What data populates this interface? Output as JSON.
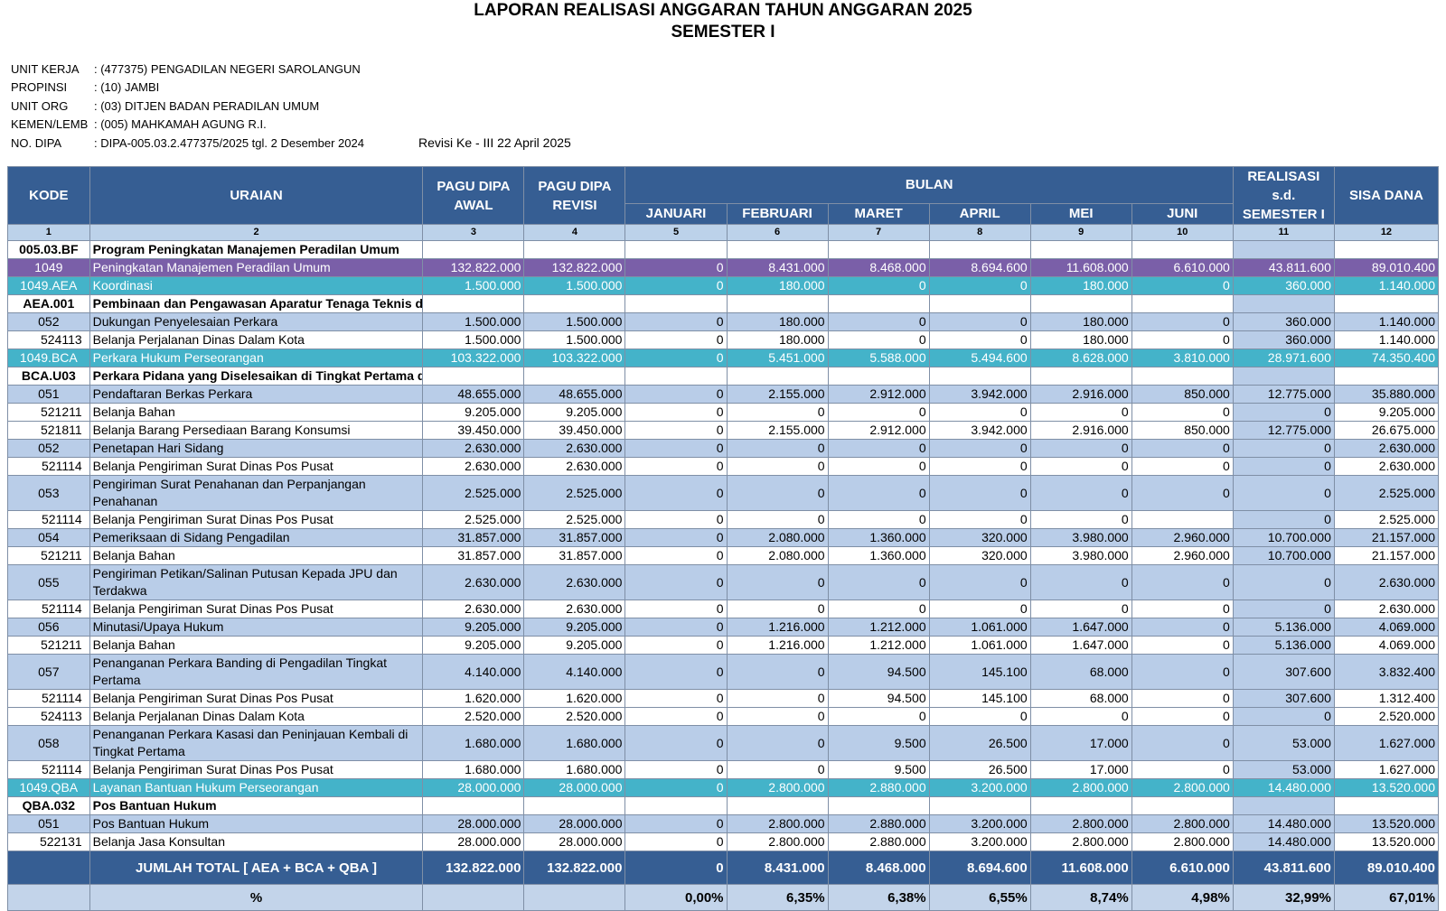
{
  "title": "LAPORAN REALISASI ANGGARAN TAHUN ANGGARAN 2025",
  "subtitle": "SEMESTER I",
  "info": [
    {
      "label": "UNIT KERJA",
      "value": ": (477375) PENGADILAN NEGERI SAROLANGUN"
    },
    {
      "label": "PROPINSI",
      "value": ": (10) JAMBI"
    },
    {
      "label": "UNIT ORG",
      "value": ": (03) DITJEN BADAN PERADILAN UMUM"
    },
    {
      "label": "KEMEN/LEMB",
      "value": ": (005) MAHKAMAH AGUNG R.I."
    },
    {
      "label": "NO. DIPA",
      "value": ": DIPA-005.03.2.477375/2025 tgl. 2 Desember 2024"
    }
  ],
  "revisi": "Revisi Ke - III 22 April 2025",
  "header": {
    "kode": "KODE",
    "uraian": "URAIAN",
    "pagu_awal": "PAGU DIPA AWAL",
    "pagu_revisi": "PAGU DIPA REVISI",
    "bulan": "BULAN",
    "months": [
      "JANUARI",
      "FEBRUARI",
      "MARET",
      "APRIL",
      "MEI",
      "JUNI"
    ],
    "realisasi": "REALISASI s.d. SEMESTER I",
    "sisa": "SISA DANA",
    "numbers": [
      "1",
      "2",
      "3",
      "4",
      "5",
      "6",
      "7",
      "8",
      "9",
      "10",
      "11",
      "12"
    ]
  },
  "rows": [
    {
      "style": "prog",
      "kode": "005.03.BF",
      "uraian": "Program Peningkatan Manajemen Peradilan Umum",
      "v": [
        "",
        "",
        "",
        "",
        "",
        "",
        "",
        "",
        "",
        ""
      ]
    },
    {
      "style": "purple",
      "kode": "1049",
      "uraian": "Peningkatan Manajemen Peradilan Umum",
      "v": [
        "132.822.000",
        "132.822.000",
        "0",
        "8.431.000",
        "8.468.000",
        "8.694.600",
        "11.608.000",
        "6.610.000",
        "43.811.600",
        "89.010.400"
      ]
    },
    {
      "style": "teal",
      "kode": "1049.AEA",
      "uraian": "Koordinasi",
      "v": [
        "1.500.000",
        "1.500.000",
        "0",
        "180.000",
        "0",
        "0",
        "180.000",
        "0",
        "360.000",
        "1.140.000"
      ]
    },
    {
      "style": "prog",
      "kode": "AEA.001",
      "uraian": "Pembinaan dan Pengawasan Aparatur Tenaga Teknis di Lingkungan Peradilan Umum",
      "v": [
        "",
        "",
        "",
        "",
        "",
        "",
        "",
        "",
        "",
        ""
      ]
    },
    {
      "style": "blue",
      "kode": "052",
      "uraian": "Dukungan Penyelesaian Perkara",
      "v": [
        "1.500.000",
        "1.500.000",
        "0",
        "180.000",
        "0",
        "0",
        "180.000",
        "0",
        "360.000",
        "1.140.000"
      ]
    },
    {
      "style": "white",
      "kode": "524113",
      "uraian": "Belanja Perjalanan Dinas Dalam Kota",
      "v": [
        "1.500.000",
        "1.500.000",
        "0",
        "180.000",
        "0",
        "0",
        "180.000",
        "0",
        "360.000",
        "1.140.000"
      ]
    },
    {
      "style": "teal",
      "kode": "1049.BCA",
      "uraian": "Perkara Hukum Perseorangan",
      "v": [
        "103.322.000",
        "103.322.000",
        "0",
        "5.451.000",
        "5.588.000",
        "5.494.600",
        "8.628.000",
        "3.810.000",
        "28.971.600",
        "74.350.400"
      ]
    },
    {
      "style": "prog",
      "kode": "BCA.U03",
      "uraian": "Perkara Pidana yang Diselesaikan di Tingkat Pertama di Wilayah Barat",
      "v": [
        "",
        "",
        "",
        "",
        "",
        "",
        "",
        "",
        "",
        ""
      ]
    },
    {
      "style": "blue",
      "kode": "051",
      "uraian": "Pendaftaran Berkas Perkara",
      "v": [
        "48.655.000",
        "48.655.000",
        "0",
        "2.155.000",
        "2.912.000",
        "3.942.000",
        "2.916.000",
        "850.000",
        "12.775.000",
        "35.880.000"
      ]
    },
    {
      "style": "white",
      "kode": "521211",
      "uraian": "Belanja Bahan",
      "v": [
        "9.205.000",
        "9.205.000",
        "0",
        "0",
        "0",
        "0",
        "0",
        "0",
        "0",
        "9.205.000"
      ]
    },
    {
      "style": "white",
      "kode": "521811",
      "uraian": "Belanja Barang Persediaan Barang Konsumsi",
      "v": [
        "39.450.000",
        "39.450.000",
        "0",
        "2.155.000",
        "2.912.000",
        "3.942.000",
        "2.916.000",
        "850.000",
        "12.775.000",
        "26.675.000"
      ]
    },
    {
      "style": "blue",
      "kode": "052",
      "uraian": "Penetapan Hari Sidang",
      "v": [
        "2.630.000",
        "2.630.000",
        "0",
        "0",
        "0",
        "0",
        "0",
        "0",
        "0",
        "2.630.000"
      ]
    },
    {
      "style": "white",
      "kode": "521114",
      "uraian": "Belanja Pengiriman Surat Dinas Pos Pusat",
      "v": [
        "2.630.000",
        "2.630.000",
        "0",
        "0",
        "0",
        "0",
        "0",
        "0",
        "0",
        "2.630.000"
      ]
    },
    {
      "style": "blue",
      "tall": true,
      "kode": "053",
      "uraian": "Pengiriman Surat Penahanan dan Perpanjangan Penahanan",
      "v": [
        "2.525.000",
        "2.525.000",
        "0",
        "0",
        "0",
        "0",
        "0",
        "0",
        "0",
        "2.525.000"
      ]
    },
    {
      "style": "white",
      "kode": "521114",
      "uraian": "Belanja Pengiriman Surat Dinas Pos Pusat",
      "v": [
        "2.525.000",
        "2.525.000",
        "0",
        "0",
        "0",
        "0",
        "0",
        "",
        "0",
        "2.525.000"
      ]
    },
    {
      "style": "blue",
      "kode": "054",
      "uraian": "Pemeriksaan di Sidang Pengadilan",
      "v": [
        "31.857.000",
        "31.857.000",
        "0",
        "2.080.000",
        "1.360.000",
        "320.000",
        "3.980.000",
        "2.960.000",
        "10.700.000",
        "21.157.000"
      ]
    },
    {
      "style": "white",
      "kode": "521211",
      "uraian": "Belanja Bahan",
      "v": [
        "31.857.000",
        "31.857.000",
        "0",
        "2.080.000",
        "1.360.000",
        "320.000",
        "3.980.000",
        "2.960.000",
        "10.700.000",
        "21.157.000"
      ]
    },
    {
      "style": "blue",
      "tall": true,
      "kode": "055",
      "uraian": "Pengiriman Petikan/Salinan Putusan Kepada JPU dan Terdakwa",
      "v": [
        "2.630.000",
        "2.630.000",
        "0",
        "0",
        "0",
        "0",
        "0",
        "0",
        "0",
        "2.630.000"
      ]
    },
    {
      "style": "white",
      "kode": "521114",
      "uraian": "Belanja Pengiriman Surat Dinas Pos Pusat",
      "v": [
        "2.630.000",
        "2.630.000",
        "0",
        "0",
        "0",
        "0",
        "0",
        "0",
        "0",
        "2.630.000"
      ]
    },
    {
      "style": "blue",
      "kode": "056",
      "uraian": "Minutasi/Upaya Hukum",
      "v": [
        "9.205.000",
        "9.205.000",
        "0",
        "1.216.000",
        "1.212.000",
        "1.061.000",
        "1.647.000",
        "0",
        "5.136.000",
        "4.069.000"
      ]
    },
    {
      "style": "white",
      "kode": "521211",
      "uraian": "Belanja Bahan",
      "v": [
        "9.205.000",
        "9.205.000",
        "0",
        "1.216.000",
        "1.212.000",
        "1.061.000",
        "1.647.000",
        "0",
        "5.136.000",
        "4.069.000"
      ]
    },
    {
      "style": "blue",
      "tall": true,
      "kode": "057",
      "uraian": "Penanganan Perkara Banding di Pengadilan Tingkat Pertama",
      "v": [
        "4.140.000",
        "4.140.000",
        "0",
        "0",
        "94.500",
        "145.100",
        "68.000",
        "0",
        "307.600",
        "3.832.400"
      ]
    },
    {
      "style": "white",
      "kode": "521114",
      "uraian": "Belanja Pengiriman Surat Dinas Pos Pusat",
      "v": [
        "1.620.000",
        "1.620.000",
        "0",
        "0",
        "94.500",
        "145.100",
        "68.000",
        "0",
        "307.600",
        "1.312.400"
      ]
    },
    {
      "style": "white",
      "kode": "524113",
      "uraian": "Belanja Perjalanan Dinas Dalam Kota",
      "v": [
        "2.520.000",
        "2.520.000",
        "0",
        "0",
        "0",
        "0",
        "0",
        "0",
        "0",
        "2.520.000"
      ]
    },
    {
      "style": "blue",
      "tall": true,
      "kode": "058",
      "uraian": "Penanganan Perkara Kasasi dan Peninjauan Kembali di Tingkat Pertama",
      "v": [
        "1.680.000",
        "1.680.000",
        "0",
        "0",
        "9.500",
        "26.500",
        "17.000",
        "0",
        "53.000",
        "1.627.000"
      ]
    },
    {
      "style": "white",
      "kode": "521114",
      "uraian": "Belanja Pengiriman Surat Dinas Pos Pusat",
      "v": [
        "1.680.000",
        "1.680.000",
        "0",
        "0",
        "9.500",
        "26.500",
        "17.000",
        "0",
        "53.000",
        "1.627.000"
      ]
    },
    {
      "style": "teal",
      "kode": "1049.QBA",
      "uraian": "Layanan Bantuan Hukum Perseorangan",
      "v": [
        "28.000.000",
        "28.000.000",
        "0",
        "2.800.000",
        "2.880.000",
        "3.200.000",
        "2.800.000",
        "2.800.000",
        "14.480.000",
        "13.520.000"
      ]
    },
    {
      "style": "prog",
      "kode": "QBA.032",
      "uraian": "Pos Bantuan Hukum",
      "v": [
        "",
        "",
        "",
        "",
        "",
        "",
        "",
        "",
        "",
        ""
      ]
    },
    {
      "style": "blue",
      "kode": "051",
      "uraian": "Pos Bantuan Hukum",
      "v": [
        "28.000.000",
        "28.000.000",
        "0",
        "2.800.000",
        "2.880.000",
        "3.200.000",
        "2.800.000",
        "2.800.000",
        "14.480.000",
        "13.520.000"
      ]
    },
    {
      "style": "white",
      "kode": "522131",
      "uraian": "Belanja Jasa Konsultan",
      "v": [
        "28.000.000",
        "28.000.000",
        "0",
        "2.800.000",
        "2.880.000",
        "3.200.000",
        "2.800.000",
        "2.800.000",
        "14.480.000",
        "13.520.000"
      ]
    }
  ],
  "total": {
    "label": "JUMLAH TOTAL [ AEA + BCA + QBA ]",
    "v": [
      "132.822.000",
      "132.822.000",
      "0",
      "8.431.000",
      "8.468.000",
      "8.694.600",
      "11.608.000",
      "6.610.000",
      "43.811.600",
      "89.010.400"
    ]
  },
  "percent": {
    "label": "%",
    "v": [
      "",
      "",
      "0,00%",
      "6,35%",
      "6,38%",
      "6,55%",
      "8,74%",
      "4,98%",
      "32,99%",
      "67,01%"
    ]
  }
}
